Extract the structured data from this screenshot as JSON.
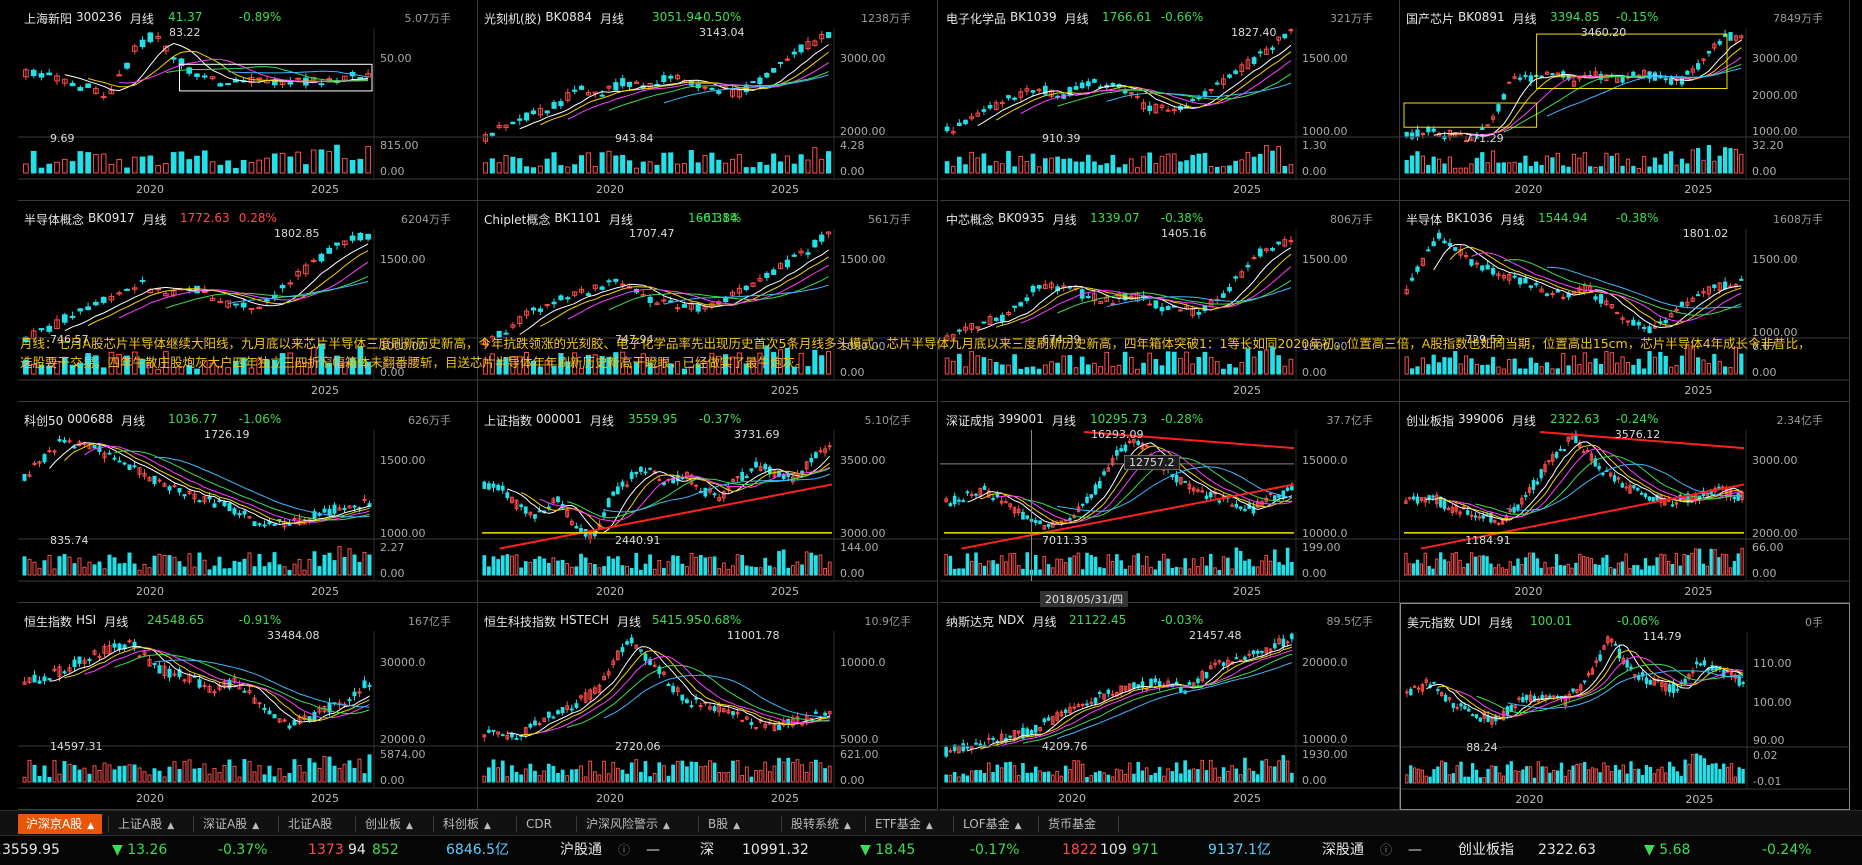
{
  "colors": {
    "up": "#ff4b4b",
    "down": "#3ddc52",
    "vol_up": "#ff4b4b",
    "vol_down": "#22e0e8",
    "grid": "#3a3a3a",
    "accent": "#e8560a",
    "annotation": "#f5c518"
  },
  "annotation": "月线：七月A股芯片半导体继续大阳线，九月底以来芯片半导体三度刷新历史新高，今年抗跌领涨的光刻胶、电子化学品率先出现历史首次5条月线多头模式，芯片半导体九月底以来三度刷新历史新高，四年箱体突破1：1等长如同2020年初，位置高三倍，A股指数也如同当期，位置高出15cm，芯片半导体4年成长今非昔比，选股要干交易。四年牛散庄股炮灰大户四年独立三四折窄幅箱体未翻番腰斩，目送芯片半导体年年刷新历史新高干瞪眼，已经做实了最牛炮灰。",
  "crosshair": {
    "price": "12757.2",
    "date": "2018/05/31/四"
  },
  "panels": [
    {
      "name": "上海新阳",
      "code": "300236",
      "period": "月线",
      "price": "41.37",
      "pct": "-0.89%",
      "vol": "5.07万手",
      "dir": "dn",
      "y_ticks": [
        "50.00",
        "815.00",
        "0.00"
      ],
      "x_ticks": [
        "2020",
        "2025"
      ],
      "labels": [
        "83.22",
        "9.69"
      ]
    },
    {
      "name": "光刻机(胶)",
      "code": "BK0884",
      "period": "月线",
      "price": "3051.94",
      "pct": "-0.50%",
      "vol": "1238万手",
      "dir": "dn",
      "y_ticks": [
        "3000.00",
        "2000.00",
        "4.28",
        "0.00"
      ],
      "x_ticks": [
        "2020",
        "2025"
      ],
      "labels": [
        "3143.04",
        "943.84"
      ]
    },
    {
      "name": "电子化学品",
      "code": "BK1039",
      "period": "月线",
      "price": "1766.61",
      "pct": "-0.66%",
      "vol": "321万手",
      "dir": "dn",
      "y_ticks": [
        "1500.00",
        "1000.00",
        "1.30",
        "0.00"
      ],
      "x_ticks": [
        "2025"
      ],
      "labels": [
        "1827.40",
        "910.39"
      ]
    },
    {
      "name": "国产芯片",
      "code": "BK0891",
      "period": "月线",
      "price": "3394.85",
      "pct": "-0.15%",
      "vol": "7849万手",
      "dir": "dn",
      "y_ticks": [
        "3000.00",
        "2000.00",
        "1000.00",
        "32.20",
        "0.00"
      ],
      "x_ticks": [
        "2020",
        "2025"
      ],
      "labels": [
        "3460.20",
        "771.29"
      ]
    },
    {
      "name": "半导体概念",
      "code": "BK0917",
      "period": "月线",
      "price": "1772.63",
      "pct": "0.28%",
      "vol": "6204万手",
      "dir": "up",
      "y_ticks": [
        "1500.00",
        "1000.00",
        "0.00"
      ],
      "x_ticks": [
        "2025"
      ],
      "labels": [
        "1802.85",
        "746.57"
      ]
    },
    {
      "name": "Chiplet概念",
      "code": "BK1101",
      "period": "月线",
      "price": "1661.84",
      "pct": "-0.31%",
      "vol": "561万手",
      "dir": "dn",
      "y_ticks": [
        "1500.00",
        "1000.00",
        "0.00"
      ],
      "x_ticks": [
        "2025"
      ],
      "labels": [
        "1707.47",
        "747.94"
      ]
    },
    {
      "name": "中芯概念",
      "code": "BK0935",
      "period": "月线",
      "price": "1339.07",
      "pct": "-0.38%",
      "vol": "806万手",
      "dir": "dn",
      "y_ticks": [
        "1500.00",
        "1000.00",
        "0.00"
      ],
      "x_ticks": [
        "2025"
      ],
      "labels": [
        "1405.16",
        "674.39"
      ]
    },
    {
      "name": "半导体",
      "code": "BK1036",
      "period": "月线",
      "price": "1544.94",
      "pct": "-0.38%",
      "vol": "1608万手",
      "dir": "dn",
      "y_ticks": [
        "1500.00",
        "1000.00",
        "6.67",
        "0.00"
      ],
      "x_ticks": [
        "2025"
      ],
      "labels": [
        "1801.02",
        "729.52"
      ]
    },
    {
      "name": "科创50",
      "code": "000688",
      "period": "月线",
      "price": "1036.77",
      "pct": "-1.06%",
      "vol": "626万手",
      "dir": "dn",
      "y_ticks": [
        "1500.00",
        "1000.00",
        "2.27",
        "0.00"
      ],
      "x_ticks": [
        "2020",
        "2025"
      ],
      "labels": [
        "1726.19",
        "835.74"
      ]
    },
    {
      "name": "上证指数",
      "code": "000001",
      "period": "月线",
      "price": "3559.95",
      "pct": "-0.37%",
      "vol": "5.10亿手",
      "dir": "dn",
      "y_ticks": [
        "3500.00",
        "3000.00",
        "144.00",
        "0.00"
      ],
      "x_ticks": [
        "2020",
        "2025"
      ],
      "labels": [
        "3731.69",
        "2440.91"
      ]
    },
    {
      "name": "深证成指",
      "code": "399001",
      "period": "月线",
      "price": "10295.73",
      "pct": "-0.28%",
      "vol": "37.7亿手",
      "dir": "dn",
      "y_ticks": [
        "15000.0",
        "10000.0",
        "199.00",
        "0.00"
      ],
      "x_ticks": [
        "2025"
      ],
      "labels": [
        "16293.09",
        "7011.33"
      ]
    },
    {
      "name": "创业板指",
      "code": "399006",
      "period": "月线",
      "price": "2322.63",
      "pct": "-0.24%",
      "vol": "2.34亿手",
      "dir": "dn",
      "y_ticks": [
        "3000.00",
        "2000.00",
        "66.00",
        "0.00"
      ],
      "x_ticks": [
        "2020",
        "2025"
      ],
      "labels": [
        "3576.12",
        "1184.91"
      ]
    },
    {
      "name": "恒生指数",
      "code": "HSI",
      "period": "月线",
      "price": "24548.65",
      "pct": "-0.91%",
      "vol": "167亿手",
      "dir": "dn",
      "y_ticks": [
        "30000.0",
        "20000.0",
        "5874.00",
        "0.00"
      ],
      "x_ticks": [
        "2020",
        "2025"
      ],
      "labels": [
        "33484.08",
        "14597.31"
      ]
    },
    {
      "name": "恒生科技指数",
      "code": "HSTECH",
      "period": "月线",
      "price": "5415.95",
      "pct": "-0.68%",
      "vol": "10.9亿手",
      "dir": "dn",
      "y_ticks": [
        "10000.0",
        "5000.0",
        "621.00",
        "0.00"
      ],
      "x_ticks": [
        "2020",
        "2025"
      ],
      "labels": [
        "11001.78",
        "2720.06"
      ]
    },
    {
      "name": "纳斯达克",
      "code": "NDX",
      "period": "月线",
      "price": "21122.45",
      "pct": "-0.03%",
      "vol": "89.5亿手",
      "dir": "dn",
      "y_ticks": [
        "20000.0",
        "10000.0",
        "1930.00",
        "0.00"
      ],
      "x_ticks": [
        "2020",
        "2025"
      ],
      "labels": [
        "21457.48",
        "4209.76"
      ]
    },
    {
      "name": "美元指数",
      "code": "UDI",
      "period": "月线",
      "price": "100.01",
      "pct": "-0.06%",
      "vol": "0手",
      "dir": "dn",
      "y_ticks": [
        "110.00",
        "100.00",
        "90.00",
        "0.02",
        "-0.01"
      ],
      "x_ticks": [
        "2020",
        "2025"
      ],
      "labels": [
        "114.79",
        "88.24"
      ]
    }
  ],
  "tabs": [
    {
      "label": "沪深京A股",
      "arrow": "▲",
      "active": true
    },
    {
      "label": "上证A股",
      "arrow": "▲"
    },
    {
      "label": "深证A股",
      "arrow": "▲"
    },
    {
      "label": "北证A股",
      "arrow": ""
    },
    {
      "label": "创业板",
      "arrow": "▲"
    },
    {
      "label": "科创板",
      "arrow": "▲"
    },
    {
      "label": "CDR",
      "arrow": ""
    },
    {
      "label": "沪深风险警示",
      "arrow": "▲"
    },
    {
      "label": "B股",
      "arrow": "▲"
    },
    {
      "label": "股转系统",
      "arrow": "▲"
    },
    {
      "label": "ETF基金",
      "arrow": "▲"
    },
    {
      "label": "LOF基金",
      "arrow": "▲"
    },
    {
      "label": "货币基金",
      "arrow": ""
    }
  ],
  "status": {
    "sh_price": "3559.95",
    "sh_chg": "▼ 13.26",
    "sh_pct": "-0.37%",
    "sh_up": "1373",
    "sh_flat": "94",
    "sh_dn": "852",
    "sh_amt": "6846.5亿",
    "hgt_label": "沪股通",
    "hgt_icon": "help-icon",
    "hgt_val": "—",
    "sz_label": "深",
    "sz_price": "10991.32",
    "sz_chg": "▼ 18.45",
    "sz_pct": "-0.17%",
    "sz_up": "1822",
    "sz_flat": "109",
    "sz_dn": "971",
    "sz_amt": "9137.1亿",
    "sgt_label": "深股通",
    "sgt_val": "—",
    "cyb_label": "创业板指",
    "cyb_price": "2322.63",
    "cyb_chg": "▼ 5.68",
    "cyb_pct": "-0.24%"
  }
}
